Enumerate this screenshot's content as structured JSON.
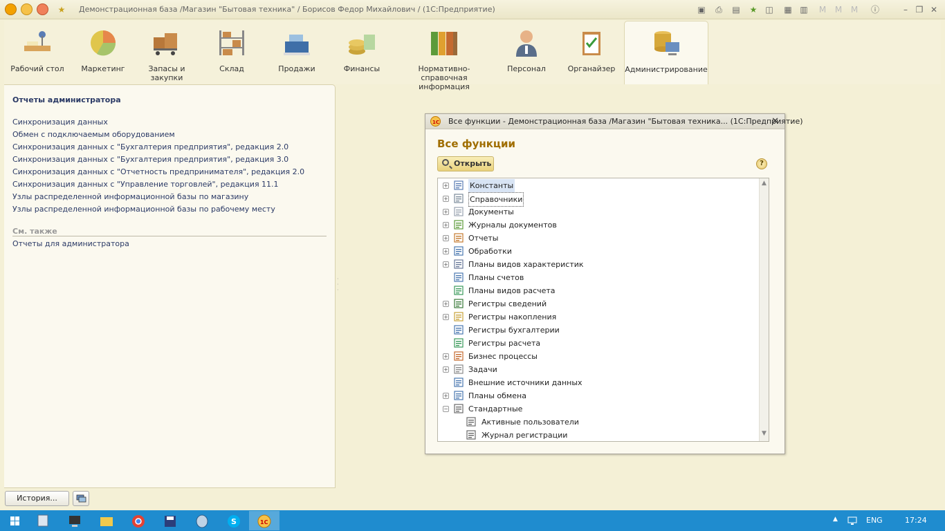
{
  "window": {
    "title": "Демонстрационная база /Магазин \"Бытовая техника\" / Борисов Федор Михайлович /  (1С:Предприятие)"
  },
  "sections": [
    {
      "label": "Рабочий стол",
      "icon": "desk-icon"
    },
    {
      "label": "Маркетинг",
      "icon": "pie-chart-icon"
    },
    {
      "label": "Запасы и закупки",
      "icon": "boxes-cart-icon"
    },
    {
      "label": "Склад",
      "icon": "shelves-icon"
    },
    {
      "label": "Продажи",
      "icon": "cash-register-icon"
    },
    {
      "label": "Финансы",
      "icon": "coins-icon"
    },
    {
      "label": "Нормативно-справочная информация",
      "icon": "binders-icon"
    },
    {
      "label": "Персонал",
      "icon": "person-icon"
    },
    {
      "label": "Органайзер",
      "icon": "clipboard-icon"
    },
    {
      "label": "Администрирование",
      "icon": "database-computer-icon"
    }
  ],
  "left_panel": {
    "heading": "Отчеты администратора",
    "links": [
      "Синхронизация данных",
      "Обмен с подключаемым оборудованием",
      "Синхронизация данных с \"Бухгалтерия предприятия\", редакция 2.0",
      "Синхронизация данных с \"Бухгалтерия предприятия\", редакция 3.0",
      "Синхронизация данных с \"Отчетность предпринимателя\", редакция 2.0",
      "Синхронизация данных с \"Управление торговлей\", редакция 11.1",
      "Узлы распределенной информационной базы по магазину",
      "Узлы распределенной информационной базы по рабочему месту"
    ],
    "see_also": "См. также",
    "see_also_links": [
      "Отчеты для администратора"
    ]
  },
  "dialog": {
    "title": "Все функции - Демонстрационная база /Магазин \"Бытовая техника...  (1С:Предприятие)",
    "heading": "Все функции",
    "open_button": "Открыть",
    "help": "?",
    "tree": [
      {
        "label": "Константы",
        "expandable": true,
        "selected": true
      },
      {
        "label": "Справочники",
        "expandable": true,
        "focused": true
      },
      {
        "label": "Документы",
        "expandable": true
      },
      {
        "label": "Журналы документов",
        "expandable": true
      },
      {
        "label": "Отчеты",
        "expandable": true
      },
      {
        "label": "Обработки",
        "expandable": true
      },
      {
        "label": "Планы видов характеристик",
        "expandable": true
      },
      {
        "label": "Планы счетов",
        "expandable": false
      },
      {
        "label": "Планы видов расчета",
        "expandable": false
      },
      {
        "label": "Регистры сведений",
        "expandable": true
      },
      {
        "label": "Регистры накопления",
        "expandable": true
      },
      {
        "label": "Регистры бухгалтерии",
        "expandable": false
      },
      {
        "label": "Регистры расчета",
        "expandable": false
      },
      {
        "label": "Бизнес процессы",
        "expandable": true
      },
      {
        "label": "Задачи",
        "expandable": true
      },
      {
        "label": "Внешние источники данных",
        "expandable": false
      },
      {
        "label": "Планы обмена",
        "expandable": true
      },
      {
        "label": "Стандартные",
        "expandable": true,
        "expanded": true
      },
      {
        "label": "Активные пользователи",
        "child": true
      },
      {
        "label": "Журнал регистрации",
        "child": true
      }
    ]
  },
  "bottom": {
    "history_button": "История..."
  },
  "taskbar": {
    "lang": "ENG",
    "time": "17:24"
  },
  "colors": {
    "accent": "#a06e00",
    "link": "#2b3a66",
    "taskbar": "#1f8ccf"
  }
}
